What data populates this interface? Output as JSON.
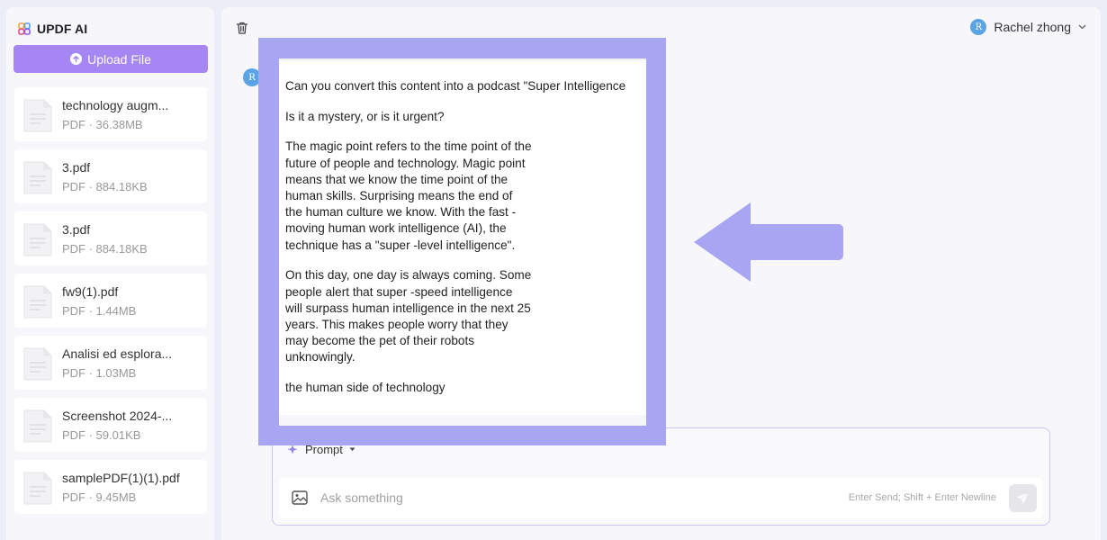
{
  "app": {
    "brand": "UPDF AI"
  },
  "sidebar": {
    "upload_label": "Upload File",
    "files": [
      {
        "name": "technology augm...",
        "meta": "PDF · 36.38MB"
      },
      {
        "name": "3.pdf",
        "meta": "PDF · 884.18KB"
      },
      {
        "name": "3.pdf",
        "meta": "PDF · 884.18KB"
      },
      {
        "name": "fw9(1).pdf",
        "meta": "PDF · 1.44MB"
      },
      {
        "name": "Analisi ed esplora...",
        "meta": "PDF · 1.03MB"
      },
      {
        "name": "Screenshot 2024-...",
        "meta": "PDF · 59.01KB"
      },
      {
        "name": "samplePDF(1)(1).pdf",
        "meta": "PDF · 9.45MB"
      }
    ]
  },
  "header": {
    "user_initial": "R",
    "user_name": "Rachel zhong"
  },
  "chat": {
    "message_avatar_initial": "R",
    "message": {
      "p1": "Can you convert this content into a podcast \"Super Intelligence",
      "p2": "Is it a mystery, or is it urgent?",
      "p3": "The magic point refers to the time point of the future of people and technology. Magic point means that we know the time point of the human skills. Surprising means the end of the human culture we know. With the fast -moving human work intelligence (AI), the technique has a \"super -level intelligence\".",
      "p4": "On this day, one day is always coming. Some people alert that super -speed intelligence will surpass human intelligence in the next 25 years. This makes people worry that they may become the pet of their robots unknowingly.",
      "p5": "the human side of technology"
    }
  },
  "input": {
    "prompt_label": "Prompt",
    "placeholder": "Ask something",
    "hint": "Enter Send; Shift + Enter Newline"
  },
  "colors": {
    "accent": "#A586F2",
    "highlight": "#A8A6F3",
    "avatar": "#5AA4E6"
  }
}
